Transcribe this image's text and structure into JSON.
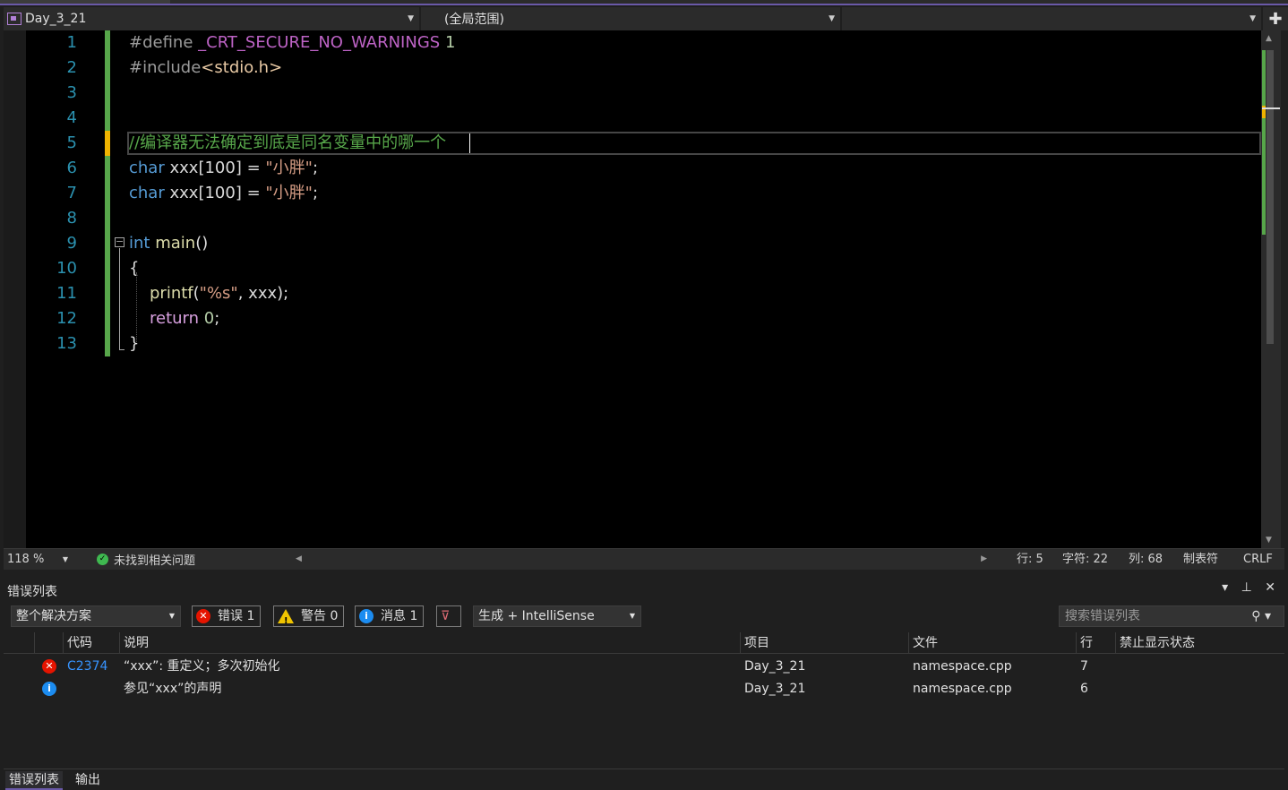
{
  "nav": {
    "project": "Day_3_21",
    "scope": "(全局范围)",
    "member": ""
  },
  "editor": {
    "line_numbers": [
      "1",
      "2",
      "3",
      "4",
      "5",
      "6",
      "7",
      "8",
      "9",
      "10",
      "11",
      "12",
      "13"
    ],
    "fold_symbol": "−"
  },
  "code": {
    "l1_define": "#define",
    "l1_macro": "_CRT_SECURE_NO_WARNINGS",
    "l1_val": "1",
    "l2_inc": "#include",
    "l2_hdr": "<stdio.h>",
    "l5_comment": "//编译器无法确定到底是同名变量中的哪一个",
    "l6_kw": "char",
    "l6_rest": "xxx[100] = ",
    "l6_str": "\"小胖\"",
    "l6_end": ";",
    "l7_kw": "char",
    "l7_rest": "xxx[100] = ",
    "l7_str": "\"小胖\"",
    "l7_end": ";",
    "l9_kw": "int",
    "l9_fn": "main",
    "l9_paren": "()",
    "l10": "{",
    "l11_fn": "printf",
    "l11_open": "(",
    "l11_str": "\"%s\"",
    "l11_rest": ", xxx);",
    "l12_kw": "return",
    "l12_num": "0",
    "l12_end": ";",
    "l13": "}"
  },
  "status": {
    "zoom": "118 %",
    "issues": "未找到相关问题",
    "line": "行: 5",
    "char": "字符: 22",
    "col": "列: 68",
    "tabs": "制表符",
    "eol": "CRLF"
  },
  "error_list": {
    "title": "错误列表",
    "scope": "整个解决方案",
    "errors_label": "错误 1",
    "warnings_label": "警告 0",
    "messages_label": "消息 1",
    "build_filter": "生成 + IntelliSense",
    "search_placeholder": "搜索错误列表",
    "headers": {
      "code": "代码",
      "desc": "说明",
      "project": "项目",
      "file": "文件",
      "line": "行",
      "suppress": "禁止显示状态"
    },
    "rows": [
      {
        "severity": "error",
        "code": "C2374",
        "desc": "“xxx”: 重定义；多次初始化",
        "project": "Day_3_21",
        "file": "namespace.cpp",
        "line": "7"
      },
      {
        "severity": "info",
        "code": "",
        "desc": "参见“xxx”的声明",
        "project": "Day_3_21",
        "file": "namespace.cpp",
        "line": "6"
      }
    ]
  },
  "bottom_tabs": [
    "错误列表",
    "输出"
  ],
  "colors": {
    "accent": "#6a59a8",
    "error": "#e51400",
    "info": "#1c8cf0",
    "warning": "#f0c400",
    "ok": "#3fb950",
    "line_number": "#2b91af",
    "keyword": "#569cd6",
    "comment": "#57a64a"
  }
}
